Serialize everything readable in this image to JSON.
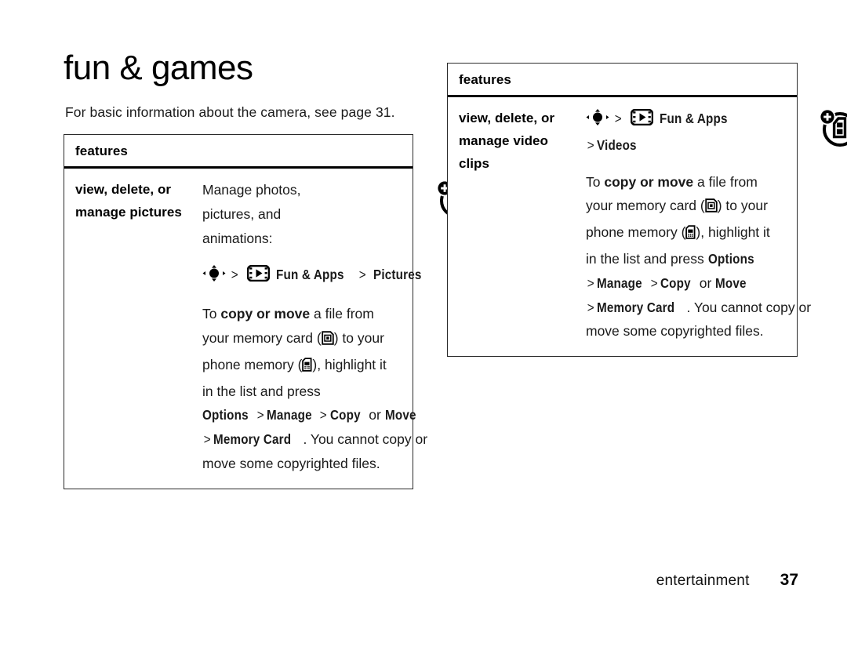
{
  "page": {
    "title": "fun & games",
    "intro": "For basic information about the camera, see page 31.",
    "footer_section": "entertainment",
    "footer_page_number": "37"
  },
  "tables": {
    "pictures": {
      "header": "features",
      "term_lines": [
        "view, delete, or",
        "manage pictures"
      ],
      "desc_lines": [
        "Manage photos,",
        "pictures, and",
        "animations:"
      ],
      "path_line": {
        "nav_icon": "navigation-key-icon",
        "sep1": ">",
        "apps_icon": "fun-and-apps-icon",
        "apps_label": "Fun & Apps",
        "sep2": ">",
        "target_label": "Pictures"
      },
      "body_text": {
        "l1_a": "To ",
        "l1_b": "copy or move",
        "l1_c": " a file from",
        "l2_a": "your memory card (",
        "l2_icon": "memory-card-icon",
        "l2_b": ") to your",
        "l3_a": "phone memory (",
        "l3_icon": "phone-memory-icon",
        "l3_b": "), highlight it",
        "l4": "in the list and press",
        "l5_options": "Options",
        "l5_gt1": ">",
        "l5_manage": "Manage",
        "l5_gt2": ">",
        "l5_copy": "Copy",
        "l5_or": "or",
        "l5_move": "Move",
        "l6_gt": ">",
        "l6_memcard": "Memory Card",
        "l6_rest": ". You cannot copy or",
        "l7": "move some copyrighted files."
      },
      "right_icon": "add-to-phone-memory-icon"
    },
    "videos": {
      "header": "features",
      "term_lines": [
        "view, delete, or",
        "manage video",
        "clips"
      ],
      "path_line": {
        "nav_icon": "navigation-key-icon",
        "sep1": ">",
        "apps_icon": "fun-and-apps-icon",
        "apps_label": "Fun & Apps",
        "sep2": ">",
        "target_label": "Videos"
      },
      "body_text": {
        "l1_a": "To ",
        "l1_b": "copy or move",
        "l1_c": " a file from",
        "l2_a": "your memory card (",
        "l2_icon": "memory-card-icon",
        "l2_b": ") to your",
        "l3_a": "phone memory (",
        "l3_icon": "phone-memory-icon",
        "l3_b": "), highlight it",
        "l4_a": "in the list and press ",
        "l4_options": "Options",
        "l5_gt1": ">",
        "l5_manage": "Manage",
        "l5_gt2": ">",
        "l5_copy": "Copy",
        "l5_or": "or",
        "l5_move": "Move",
        "l6_gt": ">",
        "l6_memcard": "Memory Card",
        "l6_rest": ". You cannot copy or",
        "l7": "move some copyrighted files."
      },
      "right_icon": "add-to-phone-memory-icon"
    }
  },
  "colors": {
    "ink": "#000000",
    "body_text": "#1a1a1a",
    "rule": "#2b2b2b",
    "paper": "#ffffff"
  }
}
